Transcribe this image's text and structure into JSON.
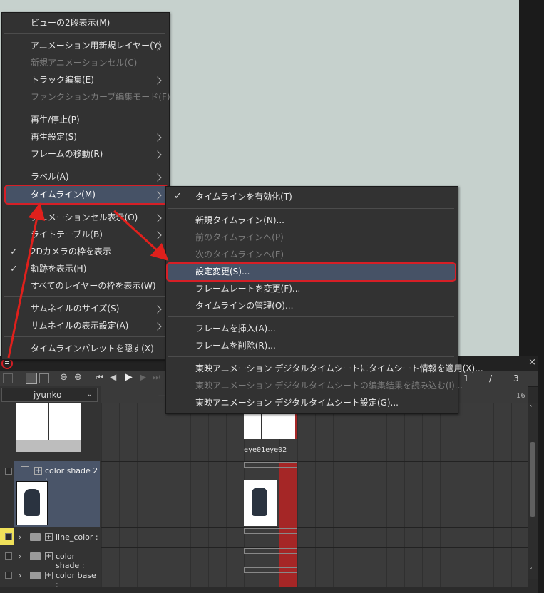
{
  "main_menu": {
    "items": [
      {
        "label": "ビューの2段表示(M)",
        "disabled": false,
        "submenu": false
      },
      {
        "label": "アニメーション用新規レイヤー(Y)",
        "disabled": false,
        "submenu": true
      },
      {
        "label": "新規アニメーションセル(C)",
        "disabled": true,
        "submenu": false
      },
      {
        "label": "トラック編集(E)",
        "disabled": false,
        "submenu": true
      },
      {
        "label": "ファンクションカーブ編集モード(F)",
        "disabled": true,
        "submenu": false
      },
      {
        "label": "再生/停止(P)",
        "disabled": false,
        "submenu": false
      },
      {
        "label": "再生設定(S)",
        "disabled": false,
        "submenu": true
      },
      {
        "label": "フレームの移動(R)",
        "disabled": false,
        "submenu": true
      },
      {
        "label": "ラベル(A)",
        "disabled": false,
        "submenu": true
      },
      {
        "label": "タイムライン(M)",
        "disabled": false,
        "submenu": true,
        "highlighted": true
      },
      {
        "label": "アニメーションセル表示(O)",
        "disabled": false,
        "submenu": true
      },
      {
        "label": "ライトテーブル(B)",
        "disabled": false,
        "submenu": true
      },
      {
        "label": "2Dカメラの枠を表示",
        "disabled": false,
        "checked": true
      },
      {
        "label": "軌跡を表示(H)",
        "disabled": false,
        "checked": true
      },
      {
        "label": "すべてのレイヤーの枠を表示(W)",
        "disabled": false
      },
      {
        "label": "サムネイルのサイズ(S)",
        "disabled": false,
        "submenu": true
      },
      {
        "label": "サムネイルの表示設定(A)",
        "disabled": false,
        "submenu": true
      },
      {
        "label": "タイムラインパレットを隠す(X)",
        "disabled": false
      }
    ]
  },
  "submenu": {
    "items": [
      {
        "label": "タイムラインを有効化(T)",
        "checked": true
      },
      {
        "label": "新規タイムライン(N)..."
      },
      {
        "label": "前のタイムラインへ(P)",
        "disabled": true
      },
      {
        "label": "次のタイムラインへ(E)",
        "disabled": true
      },
      {
        "label": "設定変更(S)...",
        "highlighted": true
      },
      {
        "label": "フレームレートを変更(F)..."
      },
      {
        "label": "タイムラインの管理(O)..."
      },
      {
        "label": "フレームを挿入(A)..."
      },
      {
        "label": "フレームを削除(R)..."
      },
      {
        "label": "東映アニメーション デジタルタイムシートにタイムシート情報を適用(X)..."
      },
      {
        "label": "東映アニメーション デジタルタイムシートの編集結果を読み込む(I)...",
        "disabled": true
      },
      {
        "label": "東映アニメーション デジタルタイムシート設定(G)..."
      }
    ]
  },
  "timeline": {
    "user_select": "jyunko",
    "frame_current": "1",
    "frame_sep": "/",
    "frame_total": "3",
    "ruler_mark": "16",
    "ruler_mark_left": "—ε",
    "cell_labels": "eye01eye02",
    "layers": [
      {
        "name": "color shade 2 :"
      },
      {
        "name": "line_color :"
      },
      {
        "name": "color shade :"
      },
      {
        "name": "color base :"
      }
    ]
  },
  "colors": {
    "highlight_border": "#d61f26",
    "highlight_fill": "#465266",
    "annotation_arrow": "#e0201c",
    "track_red": "#a52626"
  }
}
